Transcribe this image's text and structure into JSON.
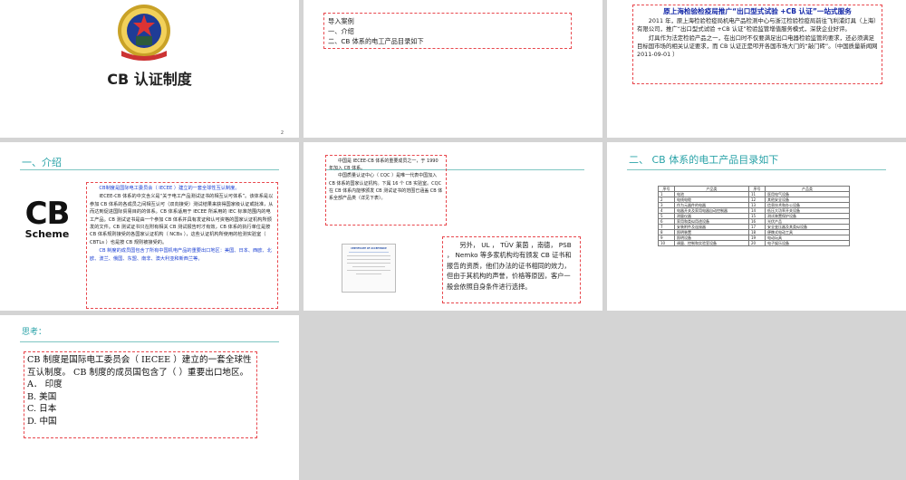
{
  "slide1": {
    "title": "CB 认证制度",
    "page_number": "2"
  },
  "slide2": {
    "lines": [
      "导入案例",
      "一、介绍",
      "二、CB 体系的电工产品目录如下"
    ]
  },
  "slide3": {
    "headline": "原上海检验检疫局推广“出口型式试验 +CB 认证”一站式服务",
    "para1": "2011 年，原上海检验检疫局机电产品检测中心与浙江检验检疫局前往飞利浦灯具（上海）有限公司，推广“出口型式试验 +CB 认证”检验监管增值服务模式，深获企业好评。",
    "para2": "灯具作为法定检验产品之一，在出口时不仅要满足出口电器检验监管的要求，还必须满足目标国市场的相关认证要求，而 CB 认证正是叩开各国市场大门的“敲门砖”。（中国质量新闻网   2011-09-01 ）"
  },
  "slide4": {
    "title": "一、介绍",
    "logo_text": "CB",
    "logo_sub": "Scheme",
    "p1": "CB制度是国际电工委员会（ IECEE ）建立的一套全球性互认制度。",
    "p2": "IECEE-CB 体系的中文含义是“关于电工产品测试证书的相互认可体系”。该体系是以参加 CB 体系的各成员之间相互认可（双向接受）测试结果来获得国家级认证或批准，从而达到促进国际贸易目的的体系。CB 体系适用于 IECEE 所采用的 IEC 标准范围内的电工产品。CB 测试证书是由一个参加 CB 体系并具有发证和认可资格的国家认证机构所颁发的文件。CB 测试证书只在附有相关 CB 测试报告时才有效，CB 体系的执行单位是按 CB 体系规则接受的各国家认证机构（ NCBs ），这些认证机构所使用的检测实验室（ CBTLs ）也是按 CB 规则被接受的。",
    "p3": "CB 制度的成员国包含了所有中国机电产品的重要出口地区：美国、日本、西欧、北欧、波兰、俄国、东盟、南非、澳大利亚和新西兰等。"
  },
  "slide5": {
    "box1_p1": "中国是 IECEE-CB 体系的重要成员之一，于 1990 年加入 CB 体系。",
    "box1_p2": "中国质量认证中心（ CQC ）是唯一代表中国加入 CB 体系的国家认证机构。下属 16 个 CB 实验室。CQC 在 CB 体系内能够颁发 CB 测试证书的范围已涵盖 CB 体系全部产品类（详见下表）。",
    "cert_title": "CERTIFICATE OF ACCEPTANCE",
    "box2": "另外， UL ， TÜV 莱茵 ，南德， PSB ，  Nemko 等多家机构均有颁发 CB 证书和报告的资质，他们办法的证书相同的效力，但由于其机构的声誉，价格等原因，客户一般会依照自身条件进行选择。"
  },
  "slide6": {
    "title": "二、 CB 体系的电工产品目录如下",
    "headers": [
      "序号",
      "产品类",
      "序号",
      "产品类"
    ],
    "rows": [
      [
        "1",
        "电池",
        "11",
        "医用电气设备"
      ],
      [
        "2",
        "电线电缆",
        "12",
        "其他安全设备"
      ],
      [
        "3",
        "作为元器件的电器",
        "13",
        "信息技术和办公设备"
      ],
      [
        "4",
        "电器开关及家用电器自动控制器",
        "14",
        "低压大功率开关设备"
      ],
      [
        "5",
        "测量仪器",
        "15",
        "测试装置保护设备"
      ],
      [
        "6",
        "家用和类似用途设备",
        "16",
        "光伏产品"
      ],
      [
        "7",
        "安装附件及连接器",
        "17",
        "安全变压器及其类似设备"
      ],
      [
        "8",
        "照明装置",
        "18",
        "便携式电动工具"
      ],
      [
        "9",
        "照明设备",
        "19",
        "电动玩具"
      ],
      [
        "10",
        "调量、控制和实验室设备",
        "20",
        "电子娱乐设备"
      ]
    ]
  },
  "slide7": {
    "title": "思考：",
    "question": "CB 制度是国际电工委员会（ IECEE ）建立的一套全球性互认制度。  CB 制度的成员国包含了（    ）重要出口地区。",
    "options": [
      "A． 印度",
      "B.  美国",
      "C.  日本",
      "D. 中国"
    ]
  }
}
